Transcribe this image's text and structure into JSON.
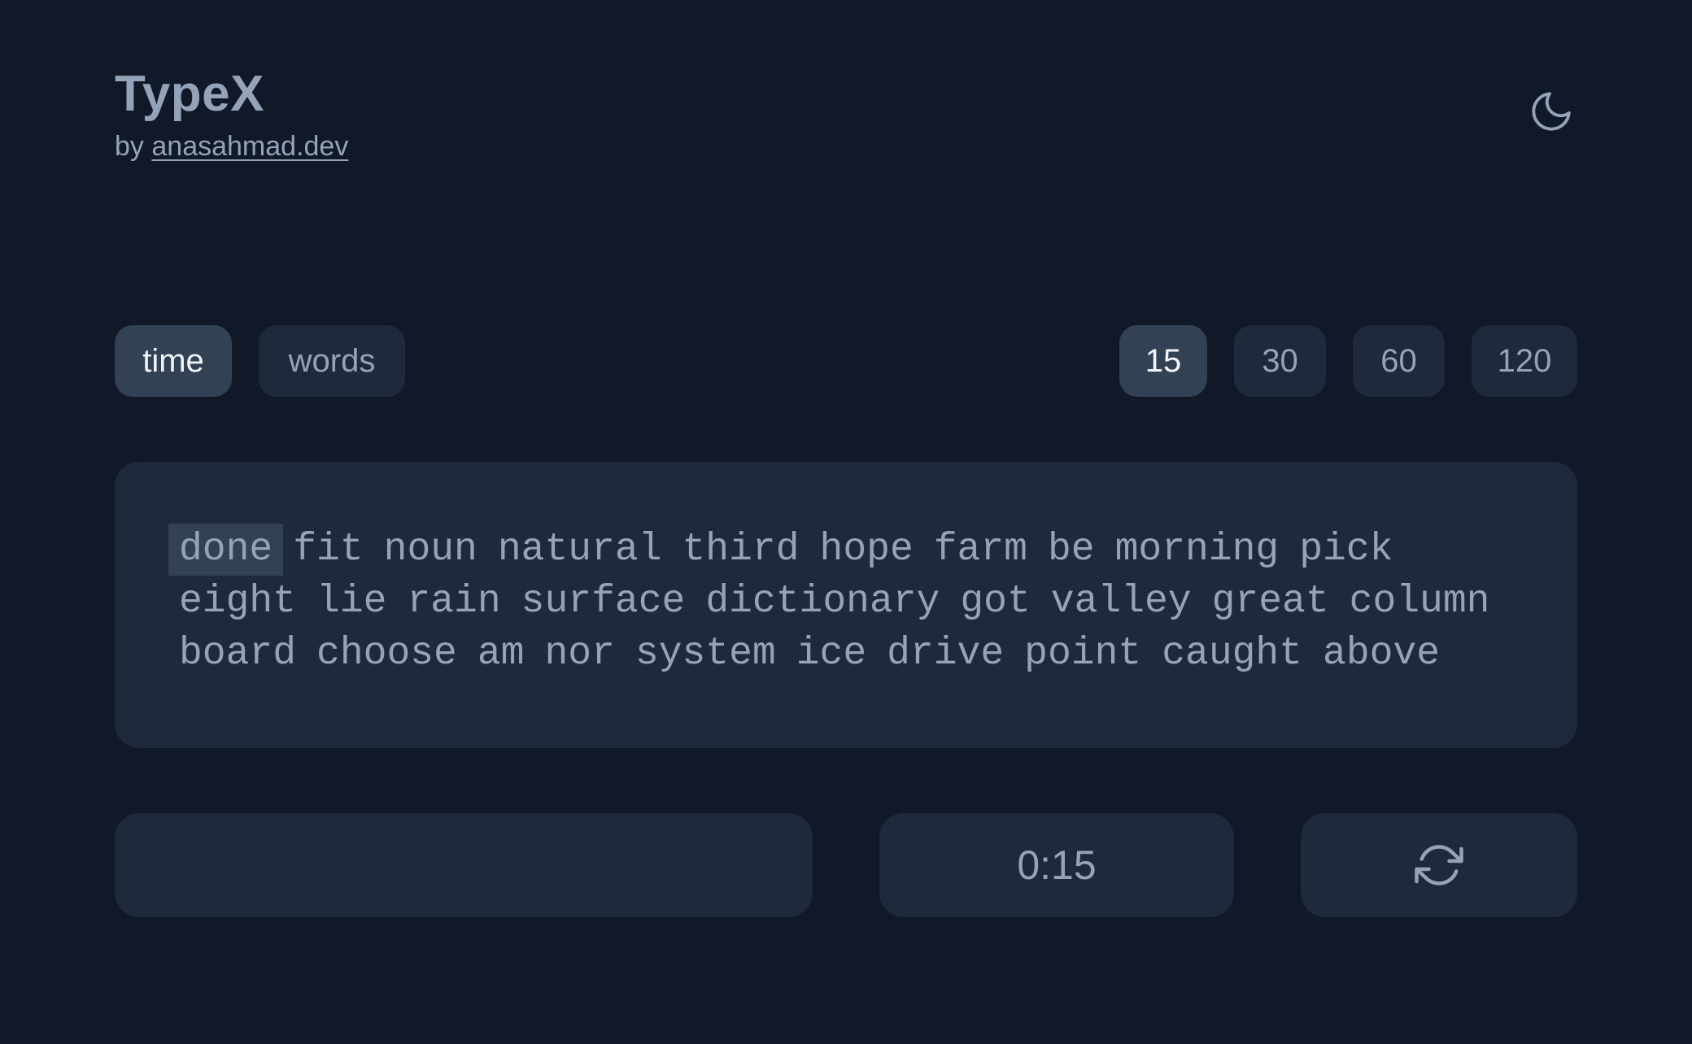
{
  "header": {
    "title": "TypeX",
    "by_prefix": "by",
    "author_link": "anasahmad.dev",
    "theme_icon": "moon-icon"
  },
  "modes": [
    {
      "label": "time",
      "active": true
    },
    {
      "label": "words",
      "active": false
    }
  ],
  "durations": [
    {
      "label": "15",
      "active": true
    },
    {
      "label": "30",
      "active": false
    },
    {
      "label": "60",
      "active": false
    },
    {
      "label": "120",
      "active": false
    }
  ],
  "test": {
    "current_word": "done",
    "lines": [
      [
        "fit",
        "noun",
        "natural",
        "third",
        "hope",
        "farm",
        "be",
        "morning",
        "pick"
      ],
      [
        "eight",
        "lie",
        "rain",
        "surface",
        "dictionary",
        "got",
        "valley",
        "great",
        "column"
      ],
      [
        "board",
        "choose",
        "am",
        "nor",
        "system",
        "ice",
        "drive",
        "point",
        "caught",
        "above"
      ]
    ]
  },
  "footer": {
    "input_value": "",
    "timer": "0:15",
    "restart_icon": "refresh-icon"
  },
  "colors": {
    "background": "#111827",
    "panel": "#1e293b",
    "active": "#334155",
    "text": "#94a3b8"
  }
}
